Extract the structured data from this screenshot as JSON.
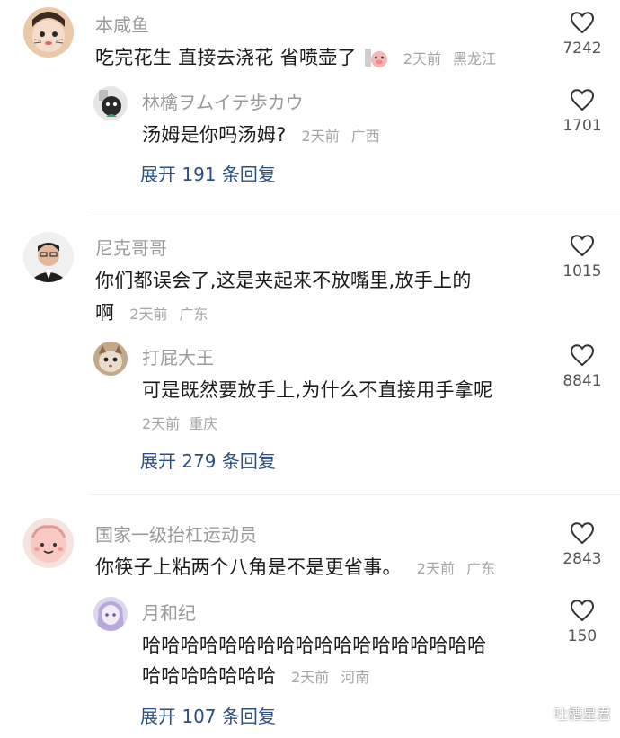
{
  "comments": [
    {
      "user": "本咸鱼",
      "text": "吃完花生 直接去浇花  省喷壶了",
      "time": "2天前",
      "location": "黑龙江",
      "likes": "7242",
      "sticker": "pig-sticker",
      "reply": {
        "user": "林檎ヲムイテ歩カウ",
        "text": "汤姆是你吗汤姆?",
        "time": "2天前",
        "location": "广西",
        "likes": "1701"
      },
      "expand": "展开 191 条回复"
    },
    {
      "user": "尼克哥哥",
      "text_line1": "你们都误会了,这是夹起来不放嘴里,放手上的",
      "text_line2": "啊",
      "time": "2天前",
      "location": "广东",
      "likes": "1015",
      "reply": {
        "user": "打屁大王",
        "text": "可是既然要放手上,为什么不直接用手拿呢",
        "time": "2天前",
        "location": "重庆",
        "likes": "8841"
      },
      "expand": "展开 279 条回复"
    },
    {
      "user": "国家一级抬杠运动员",
      "text": "你筷子上粘两个八角是不是更省事。",
      "time": "2天前",
      "location": "广东",
      "likes": "2843",
      "reply": {
        "user": "月和纪",
        "text_line1": "哈哈哈哈哈哈哈哈哈哈哈哈哈哈哈哈哈哈",
        "text_line2": "哈哈哈哈哈哈哈",
        "time": "2天前",
        "location": "河南",
        "likes": "150"
      },
      "expand": "展开 107 条回复"
    }
  ],
  "watermark": "吐槽星君",
  "icons": {
    "like": "heart-outline-icon",
    "watermark": "wechat-icon"
  },
  "colors": {
    "name": "#9a9a9a",
    "text": "#1b1b1b",
    "meta": "#a6a6a6",
    "expand": "#2d4f80"
  }
}
